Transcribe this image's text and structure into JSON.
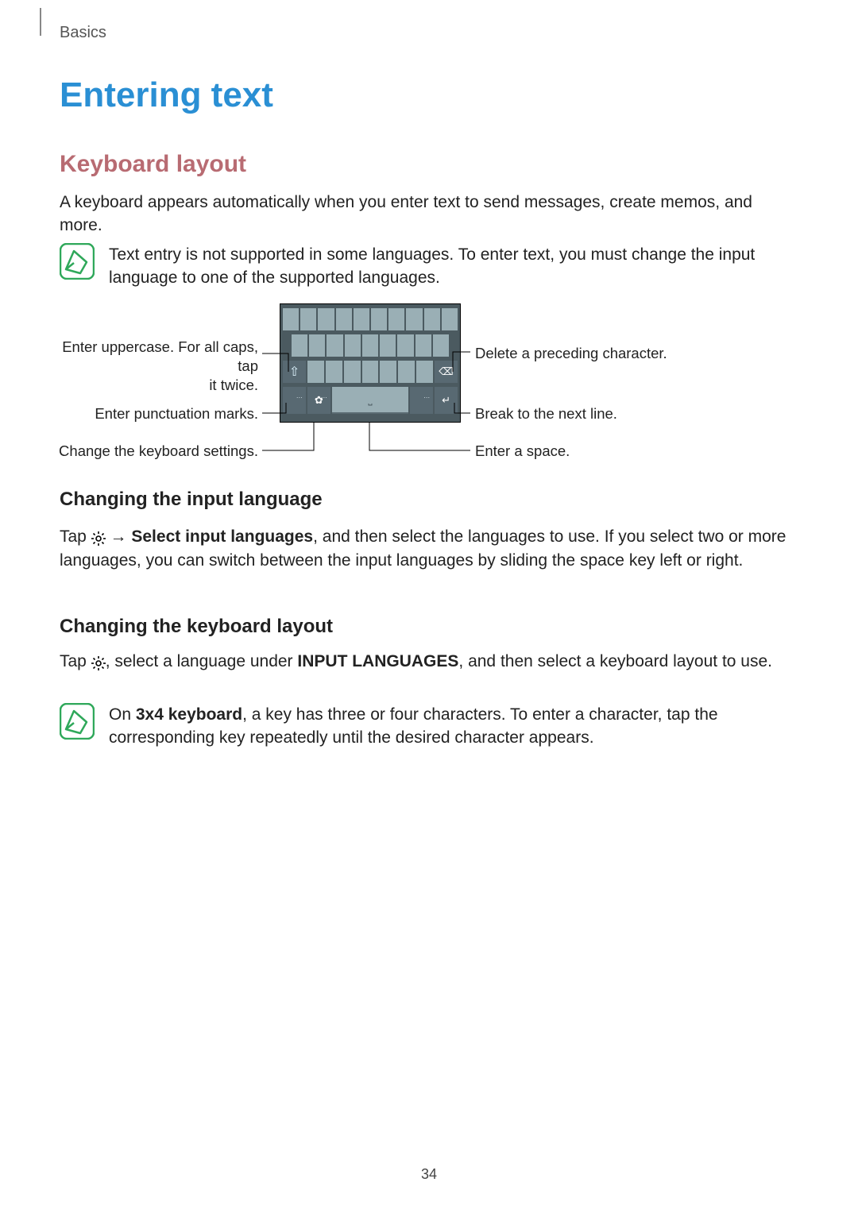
{
  "breadcrumb": "Basics",
  "h1": "Entering text",
  "h2": "Keyboard layout",
  "intro": "A keyboard appears automatically when you enter text to send messages, create memos, and more.",
  "note1": "Text entry is not supported in some languages. To enter text, you must change the input language to one of the supported languages.",
  "callouts": {
    "uppercase_line1": "Enter uppercase. For all caps, tap",
    "uppercase_line2": "it twice.",
    "punctuation": "Enter punctuation marks.",
    "settings": "Change the keyboard settings.",
    "delete": "Delete a preceding character.",
    "nextline": "Break to the next line.",
    "space": "Enter a space."
  },
  "h3a": "Changing the input language",
  "para_a_prefix": "Tap ",
  "para_a_arrow": " → ",
  "para_a_bold": "Select input languages",
  "para_a_rest": ", and then select the languages to use. If you select two or more languages, you can switch between the input languages by sliding the space key left or right.",
  "h3b": "Changing the keyboard layout",
  "para_b_prefix": "Tap ",
  "para_b_mid1": ", select a language under ",
  "para_b_caps": "INPUT LANGUAGES",
  "para_b_rest": ", and then select a keyboard layout to use.",
  "note2_prefix": "On ",
  "note2_bold": "3x4 keyboard",
  "note2_rest": ", a key has three or four characters. To enter a character, tap the corresponding key repeatedly until the desired character appears.",
  "page_number": "34"
}
